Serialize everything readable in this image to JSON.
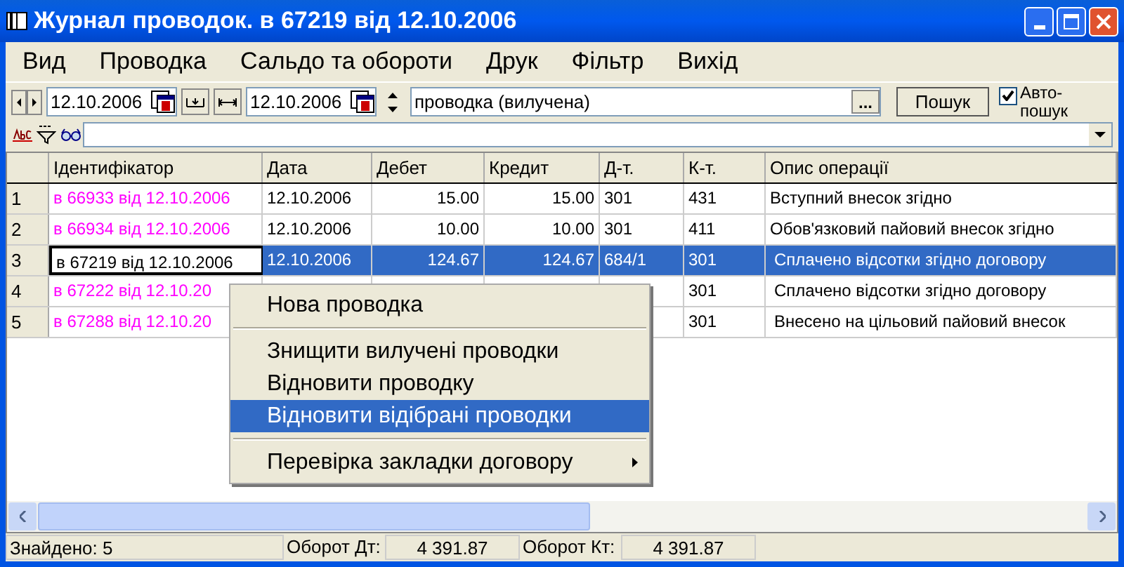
{
  "window": {
    "title": "Журнал проводок. в 67219 від 12.10.2006"
  },
  "menu": [
    "Вид",
    "Проводка",
    "Сальдо та обороти",
    "Друк",
    "Фільтр",
    "Вихід"
  ],
  "toolbar": {
    "date_from": "12.10.2006",
    "date_to": "12.10.2006",
    "filter_value": "проводка (вилучена)",
    "browse_button": "...",
    "search_button": "Пошук",
    "auto_search": {
      "label": "Авто-пошук",
      "checked": true
    }
  },
  "table": {
    "columns": [
      "Ідентифікатор",
      "Дата",
      "Дебет",
      "Кредит",
      "Д-т.",
      "К-т.",
      "Опис операції"
    ],
    "rows": [
      {
        "num": "1",
        "cells": [
          "в 66933 від 12.10.2006",
          "12.10.2006",
          "15.00",
          "15.00",
          "301",
          "431",
          "Вступний внесок згідно"
        ],
        "selected": false
      },
      {
        "num": "2",
        "cells": [
          "в 66934 від 12.10.2006",
          "12.10.2006",
          "10.00",
          "10.00",
          "301",
          "411",
          "Обов'язковий пайовий внесок згідно"
        ],
        "selected": false
      },
      {
        "num": "3",
        "cells": [
          "в 67219 від 12.10.2006",
          "12.10.2006",
          "124.67",
          "124.67",
          "684/1",
          "301",
          "Сплачено відсотки згідно договору"
        ],
        "selected": true
      },
      {
        "num": "4",
        "cells": [
          "в 67222 від 12.10.20",
          "",
          "",
          "",
          "",
          "301",
          "Сплачено відсотки згідно договору"
        ],
        "selected": false
      },
      {
        "num": "5",
        "cells": [
          "в 67288 від 12.10.20",
          "",
          "",
          "",
          "",
          "301",
          "Внесено на цільовий пайовий внесок"
        ],
        "selected": false
      }
    ]
  },
  "context_menu": [
    {
      "kind": "item",
      "label": "Нова проводка",
      "selected": false
    },
    {
      "kind": "separator"
    },
    {
      "kind": "item",
      "label": "Знищити вилучені проводки",
      "selected": false
    },
    {
      "kind": "item",
      "label": "Відновити проводку",
      "selected": false
    },
    {
      "kind": "item",
      "label": "Відновити відібрані проводки",
      "selected": true
    },
    {
      "kind": "separator"
    },
    {
      "kind": "submenu",
      "label": "Перевірка закладки договору",
      "selected": false
    }
  ],
  "status_bar": {
    "found": "Знайдено: 5",
    "debit_label": "Оборот Дт:",
    "debit_value": "4 391.87",
    "credit_label": "Оборот Кт:",
    "credit_value": "4 391.87"
  }
}
